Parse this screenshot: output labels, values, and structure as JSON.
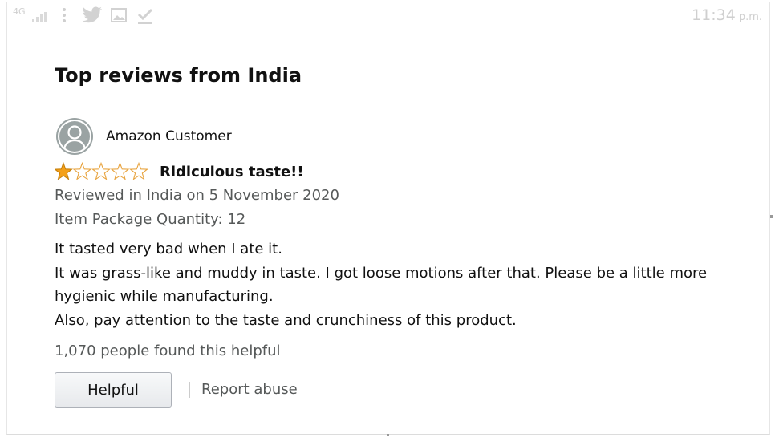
{
  "statusbar": {
    "network": "4G",
    "time": "11:34",
    "ampm": "p.m.",
    "icons": [
      "signal-icon",
      "more-vert-icon",
      "twitter-icon",
      "image-icon",
      "download-done-icon"
    ]
  },
  "section_title": "Top reviews from India",
  "review": {
    "author": "Amazon Customer",
    "rating": 1,
    "rating_max": 5,
    "title": "Ridiculous taste!!",
    "date_line": "Reviewed in India on 5 November 2020",
    "variant_line": "Item Package Quantity: 12",
    "body": [
      "It tasted very bad when I ate it.",
      "It was grass-like and muddy in taste. I got loose motions after that. Please be a little more hygienic while manufacturing.",
      "Also, pay attention to the taste and crunchiness of this product."
    ],
    "helpful_count": "1,070 people found this helpful"
  },
  "actions": {
    "helpful_label": "Helpful",
    "report_label": "Report abuse"
  },
  "colors": {
    "star": "#f4a019",
    "star_empty_stroke": "#e8a33d",
    "muted_text": "#565959",
    "avatar": "#9aa3a3"
  }
}
